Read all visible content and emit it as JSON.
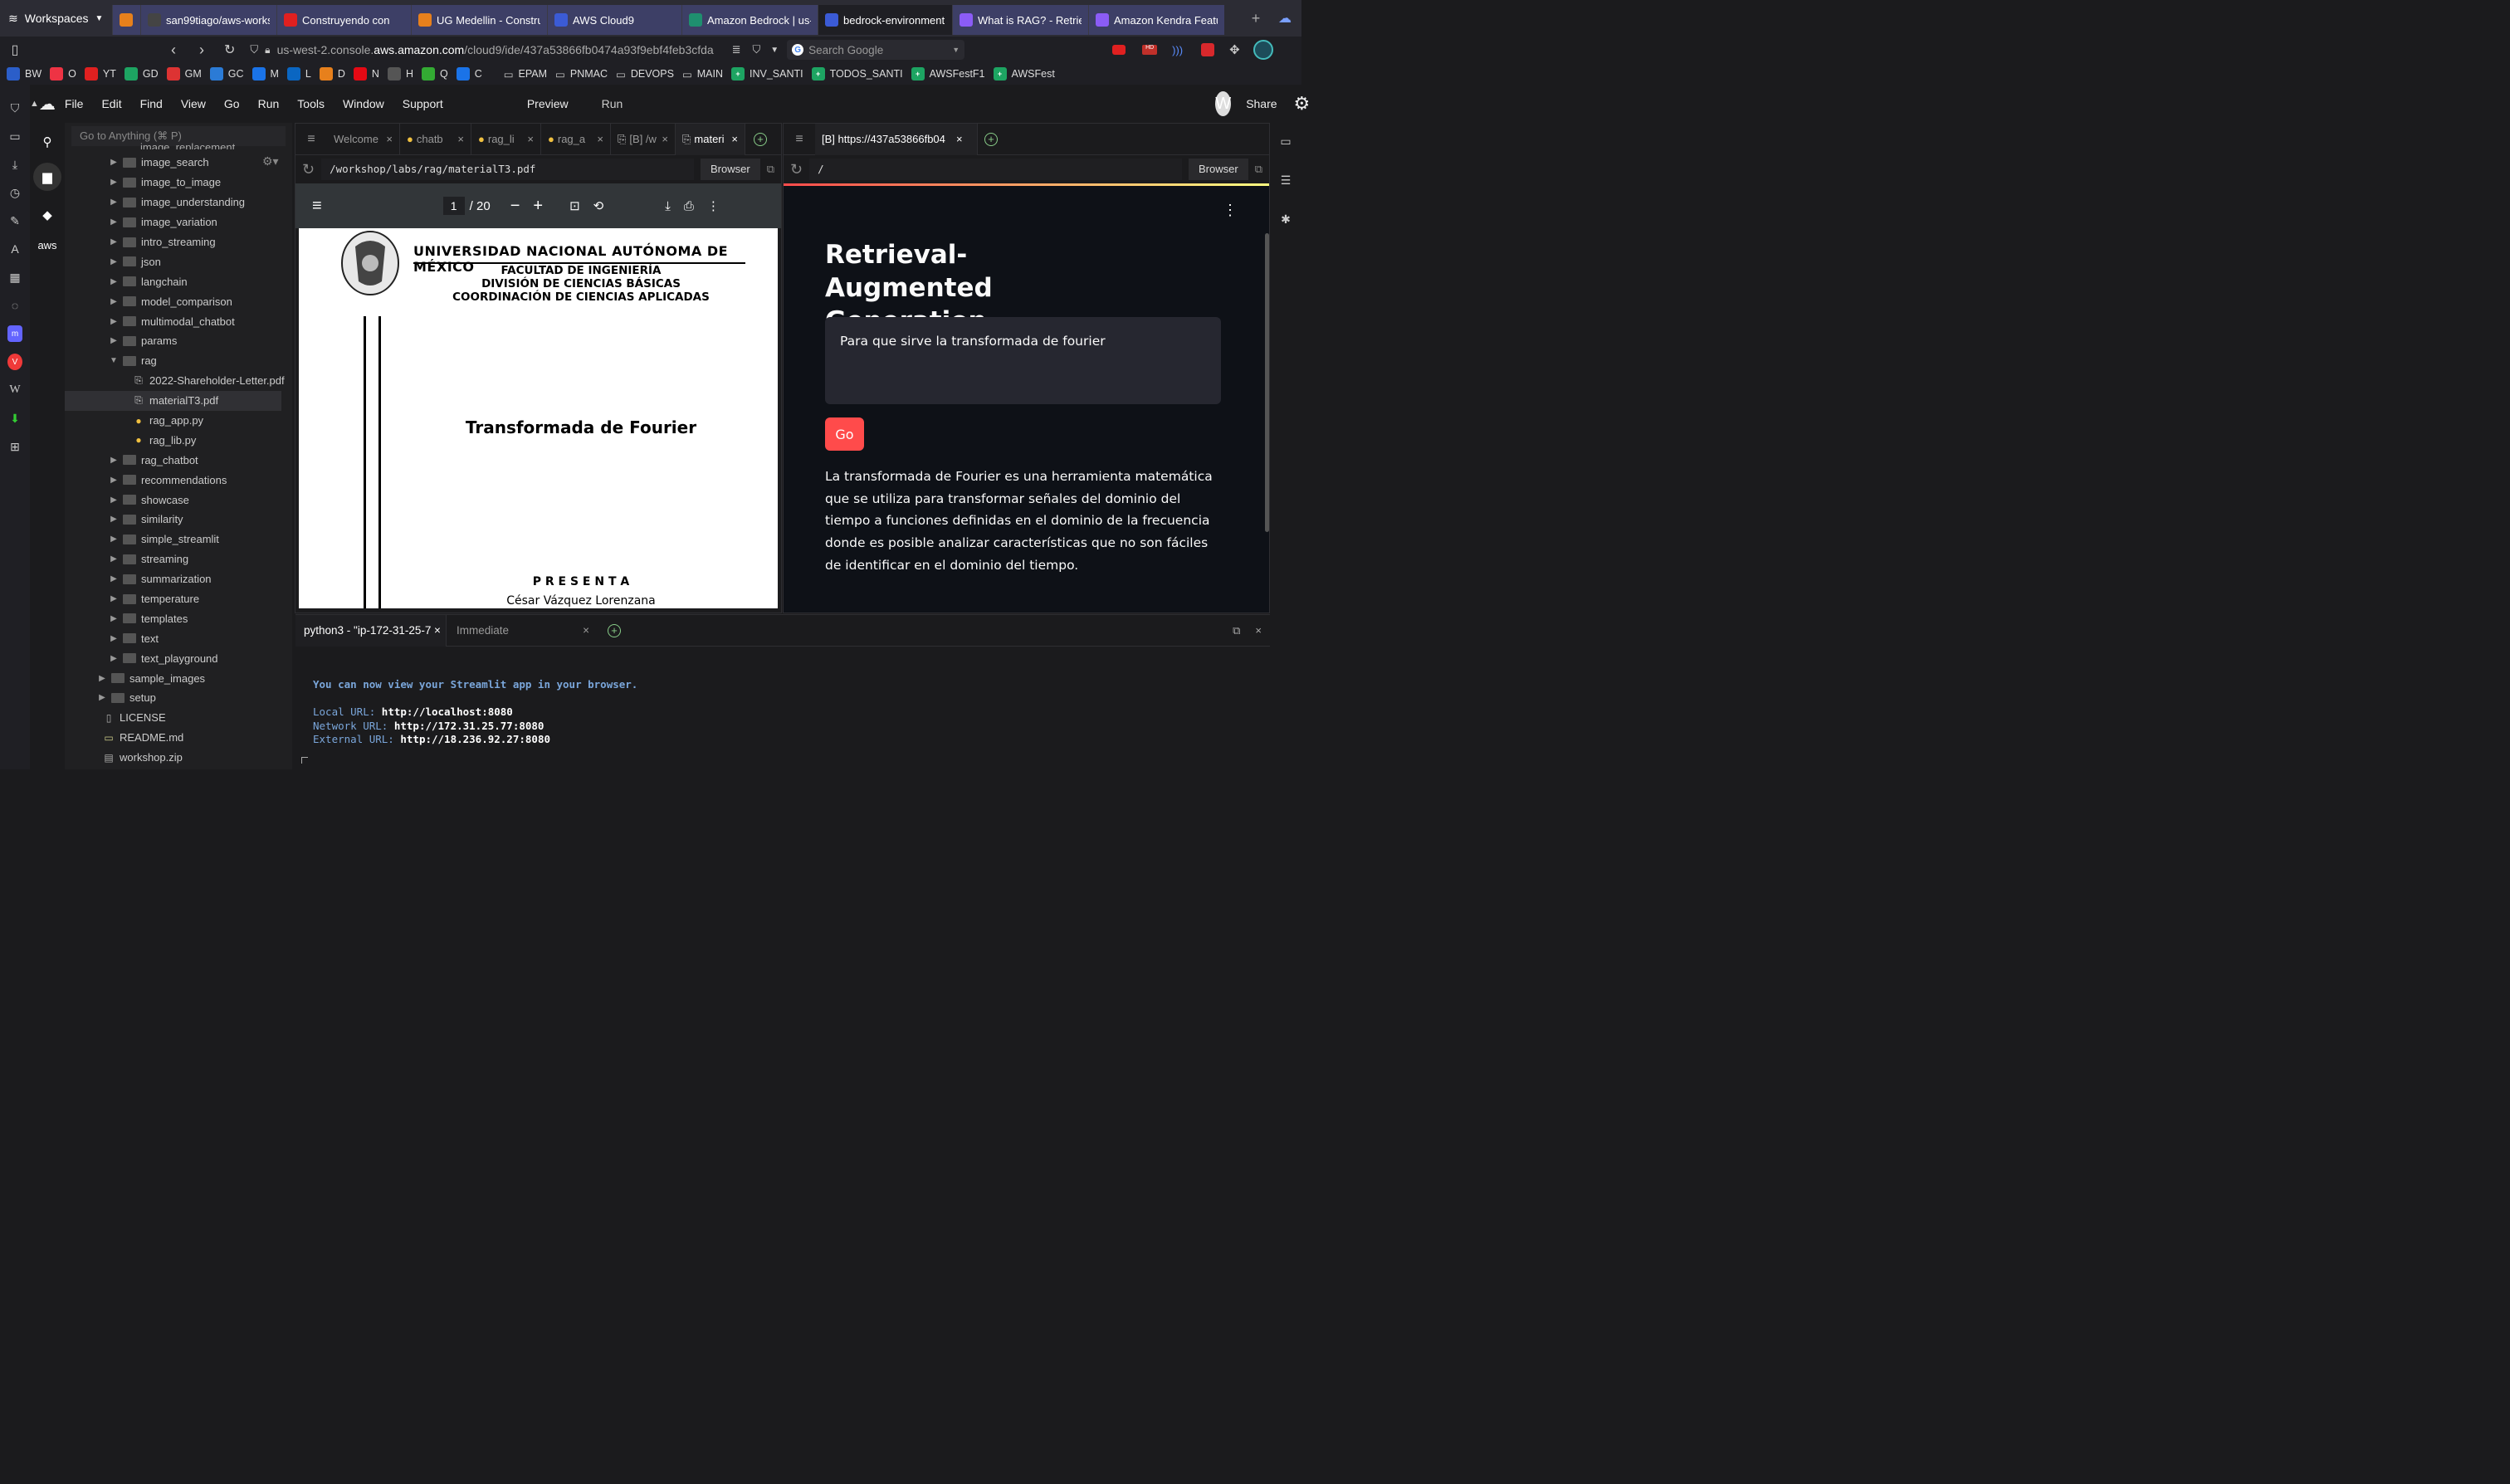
{
  "browser": {
    "workspaces_label": "Workspaces",
    "tabs": [
      {
        "label": "",
        "icon": "lambda-icon",
        "color": "#e7801c"
      },
      {
        "label": "san99tiago/aws-works",
        "icon": "github-icon",
        "color": "#444"
      },
      {
        "label": "Construyendo con",
        "icon": "youtube-icon",
        "color": "#e02020"
      },
      {
        "label": "UG Medellin - Constru",
        "icon": "meetup-icon",
        "color": "#e7801c"
      },
      {
        "label": "AWS Cloud9",
        "icon": "cloud9-icon",
        "color": "#3b5bd6"
      },
      {
        "label": "Amazon Bedrock | us-",
        "icon": "bedrock-icon",
        "color": "#1f8f6f"
      },
      {
        "label": "bedrock-environment",
        "icon": "cloud9-icon",
        "color": "#3b5bd6"
      },
      {
        "label": "What is RAG? - Retriev",
        "icon": "aws-cube-icon",
        "color": "#8b5cf6"
      },
      {
        "label": "Amazon Kendra Featur",
        "icon": "aws-cube-icon",
        "color": "#8b5cf6"
      }
    ],
    "url_prefix": "us-west-2.console.",
    "url_domain": "aws.amazon.com",
    "url_path": "/cloud9/ide/437a53866fb0474a93f9ebf4feb3cfda",
    "search_placeholder": "Search Google",
    "bookmarks": [
      "BW",
      "O",
      "YT",
      "GD",
      "GM",
      "GC",
      "M",
      "L",
      "D",
      "N",
      "H",
      "Q",
      "C",
      "EPAM",
      "PNMAC",
      "DEVOPS",
      "MAIN",
      "INV_SANTI",
      "TODOS_SANTI",
      "AWSFestF1",
      "AWSFest"
    ]
  },
  "ide": {
    "menu": [
      "File",
      "Edit",
      "Find",
      "View",
      "Go",
      "Run",
      "Tools",
      "Window",
      "Support"
    ],
    "preview_label": "Preview",
    "run_label": "Run",
    "avatar_letter": "W",
    "share_label": "Share",
    "goto_placeholder": "Go to Anything (⌘ P)",
    "aws_label": "aws",
    "tree": [
      {
        "label": "image_search",
        "type": "folder",
        "depth": 1
      },
      {
        "label": "image_to_image",
        "type": "folder",
        "depth": 1
      },
      {
        "label": "image_understanding",
        "type": "folder",
        "depth": 1
      },
      {
        "label": "image_variation",
        "type": "folder",
        "depth": 1
      },
      {
        "label": "intro_streaming",
        "type": "folder",
        "depth": 1
      },
      {
        "label": "json",
        "type": "folder",
        "depth": 1
      },
      {
        "label": "langchain",
        "type": "folder",
        "depth": 1
      },
      {
        "label": "model_comparison",
        "type": "folder",
        "depth": 1
      },
      {
        "label": "multimodal_chatbot",
        "type": "folder",
        "depth": 1
      },
      {
        "label": "params",
        "type": "folder",
        "depth": 1
      },
      {
        "label": "rag",
        "type": "folder-open",
        "depth": 1
      },
      {
        "label": "2022-Shareholder-Letter.pdf",
        "type": "pdf",
        "depth": 2
      },
      {
        "label": "materialT3.pdf",
        "type": "pdf",
        "depth": 2,
        "selected": true
      },
      {
        "label": "rag_app.py",
        "type": "py",
        "depth": 2
      },
      {
        "label": "rag_lib.py",
        "type": "py",
        "depth": 2
      },
      {
        "label": "rag_chatbot",
        "type": "folder",
        "depth": 1
      },
      {
        "label": "recommendations",
        "type": "folder",
        "depth": 1
      },
      {
        "label": "showcase",
        "type": "folder",
        "depth": 1
      },
      {
        "label": "similarity",
        "type": "folder",
        "depth": 1
      },
      {
        "label": "simple_streamlit",
        "type": "folder",
        "depth": 1
      },
      {
        "label": "streaming",
        "type": "folder",
        "depth": 1
      },
      {
        "label": "summarization",
        "type": "folder",
        "depth": 1
      },
      {
        "label": "temperature",
        "type": "folder",
        "depth": 1
      },
      {
        "label": "templates",
        "type": "folder",
        "depth": 1
      },
      {
        "label": "text",
        "type": "folder",
        "depth": 1
      },
      {
        "label": "text_playground",
        "type": "folder",
        "depth": 1
      },
      {
        "label": "sample_images",
        "type": "folder",
        "depth": 0
      },
      {
        "label": "setup",
        "type": "folder",
        "depth": 0
      },
      {
        "label": "LICENSE",
        "type": "file",
        "depth": 0
      },
      {
        "label": "README.md",
        "type": "md",
        "depth": 0
      },
      {
        "label": "workshop.zip",
        "type": "zip",
        "depth": 0
      }
    ],
    "tree_partial_top": "image_replacement"
  },
  "left_pane": {
    "tabs": [
      "Welcome",
      "chatb",
      "rag_li",
      "rag_a",
      "[B] /w",
      "materi"
    ],
    "path": "/workshop/labs/rag/materialT3.pdf",
    "browser_label": "Browser",
    "pdf": {
      "page": "1",
      "total": "/ 20",
      "univ": "UNIVERSIDAD NACIONAL AUTÓNOMA DE MÉXICO",
      "fac": "FACULTAD DE INGENIERÍA",
      "div": "DIVISIÓN DE CIENCIAS BÁSICAS",
      "coord": "COORDINACIÓN DE CIENCIAS APLICADAS",
      "title": "Transformada de Fourier",
      "presenta": "P R E S E N T A",
      "author": "César Vázquez Lorenzana"
    }
  },
  "right_pane": {
    "tab": "[B] https://437a53866fb04",
    "path": "/",
    "browser_label": "Browser",
    "app": {
      "title": "Retrieval-Augmented Generation",
      "input_value": "Para que sirve la transformada de fourier",
      "go_label": "Go",
      "answer": "La transformada de Fourier es una herramienta matemática que se utiliza para transformar señales del dominio del tiempo a funciones definidas en el dominio de la frecuencia donde es posible analizar características que no son fáciles de identificar en el dominio del tiempo."
    }
  },
  "terminal": {
    "tab1": "python3 - \"ip-172-31-25-7",
    "tab2": "Immediate",
    "view_msg": "You can now view your Streamlit app in your browser.",
    "local_label": "Local URL:",
    "local_url": "http://localhost:8080",
    "network_label": "Network URL:",
    "network_url": "http://172.31.25.77:8080",
    "external_label": "External URL:",
    "external_url": "http://18.236.92.27:8080"
  }
}
